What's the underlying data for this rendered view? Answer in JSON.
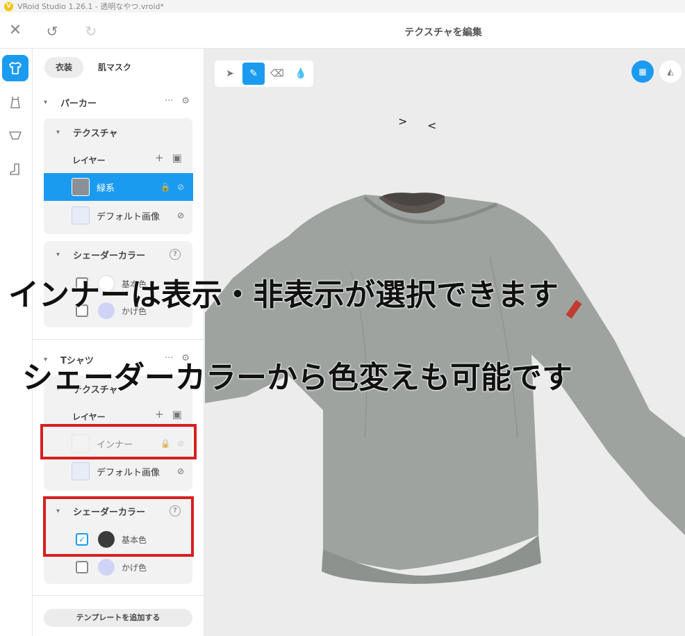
{
  "window": {
    "title": "VRoid Studio 1.26.1 - 透明なやつ.vroid*"
  },
  "header": {
    "title": "テクスチャを編集"
  },
  "panel": {
    "tabs": [
      {
        "label": "衣装",
        "active": true
      },
      {
        "label": "肌マスク",
        "active": false
      }
    ],
    "parka": {
      "name": "パーカー",
      "texture_title": "テクスチャ",
      "layer_label": "レイヤー",
      "layers": [
        {
          "name": "緑系",
          "selected": true
        },
        {
          "name": "デフォルト画像",
          "selected": false
        }
      ],
      "shader_title": "シェーダーカラー",
      "colors": [
        {
          "name": "基本色",
          "checked": false,
          "swatch": "#ffffff"
        },
        {
          "name": "かげ色",
          "checked": false,
          "swatch": "#cfd3f5"
        }
      ]
    },
    "tshirt": {
      "name": "Tシャツ",
      "texture_title": "テクスチャ",
      "layer_label": "レイヤー",
      "layers": [
        {
          "name": "インナー",
          "selected": false
        },
        {
          "name": "デフォルト画像",
          "selected": false
        }
      ],
      "shader_title": "シェーダーカラー",
      "colors": [
        {
          "name": "基本色",
          "checked": true,
          "swatch": "#3b3b3b"
        },
        {
          "name": "かげ色",
          "checked": false,
          "swatch": "#cfd3f5"
        }
      ]
    },
    "add_template_label": "テンプレートを追加する"
  },
  "viewport": {
    "tools": [
      "pointer-icon",
      "pen-icon",
      "eraser-icon",
      "dropper-icon"
    ],
    "active_tool": "pen-icon"
  },
  "annotations": {
    "line1": "インナーは表示・非表示が選択できます",
    "line2": "シェーダーカラーから色変えも可能です"
  },
  "colors": {
    "accent": "#1a9bf0",
    "highlight": "#d62020"
  }
}
